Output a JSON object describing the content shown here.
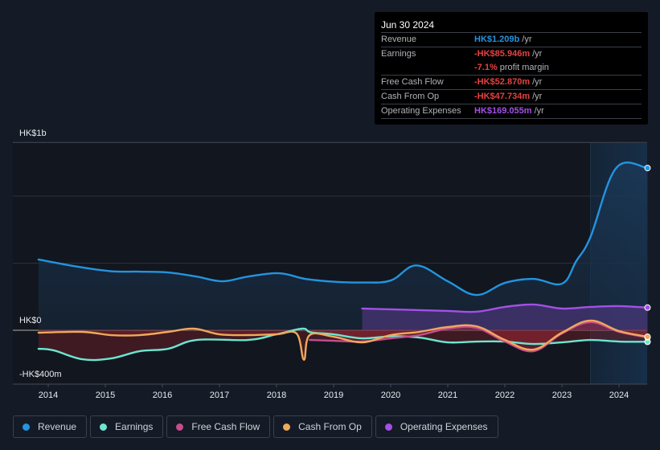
{
  "tooltip": {
    "date": "Jun 30 2024",
    "rows": [
      {
        "label": "Revenue",
        "value": "HK$1.209b",
        "unit": "/yr",
        "color": "#2394df"
      },
      {
        "label": "Earnings",
        "value": "-HK$85.946m",
        "unit": "/yr",
        "color": "#e64141"
      },
      {
        "label": "",
        "value": "-7.1%",
        "unit": "profit margin",
        "color": "#e64141"
      },
      {
        "label": "Free Cash Flow",
        "value": "-HK$52.870m",
        "unit": "/yr",
        "color": "#e64141"
      },
      {
        "label": "Cash From Op",
        "value": "-HK$47.734m",
        "unit": "/yr",
        "color": "#e64141"
      },
      {
        "label": "Operating Expenses",
        "value": "HK$169.055m",
        "unit": "/yr",
        "color": "#a450e6"
      }
    ]
  },
  "legend": [
    {
      "label": "Revenue",
      "color": "#2394df"
    },
    {
      "label": "Earnings",
      "color": "#6ce5d1"
    },
    {
      "label": "Free Cash Flow",
      "color": "#c84b8b"
    },
    {
      "label": "Cash From Op",
      "color": "#f0a95a"
    },
    {
      "label": "Operating Expenses",
      "color": "#a450e6"
    }
  ],
  "chart_data": {
    "type": "line",
    "title": "",
    "xlabel": "",
    "ylabel": "",
    "currency": "HK$",
    "units": "millions",
    "y_axis_labels": [
      "HK$1b",
      "HK$0",
      "-HK$400m"
    ],
    "ylim": [
      -400,
      1400
    ],
    "xlim": [
      2013.8,
      2024.5
    ],
    "x_ticks": [
      "2014",
      "2015",
      "2016",
      "2017",
      "2018",
      "2019",
      "2020",
      "2021",
      "2022",
      "2023",
      "2024"
    ],
    "grid": true,
    "highlight_from": 2023.5,
    "series": [
      {
        "name": "Revenue",
        "color": "#2394df",
        "x": [
          2013.83,
          2014.5,
          2015.1,
          2015.6,
          2016.1,
          2016.6,
          2017.05,
          2017.5,
          2018.05,
          2018.5,
          2019.0,
          2019.5,
          2020.0,
          2020.45,
          2021.0,
          2021.5,
          2022.0,
          2022.5,
          2023.0,
          2023.25,
          2023.5,
          2023.95,
          2024.5
        ],
        "values": [
          527,
          475,
          440,
          437,
          431,
          400,
          365,
          400,
          425,
          383,
          362,
          356,
          371,
          483,
          365,
          263,
          353,
          383,
          347,
          515,
          695,
          1209,
          1209
        ]
      },
      {
        "name": "Earnings",
        "color": "#6ce5d1",
        "x": [
          2013.83,
          2014.1,
          2014.6,
          2015.1,
          2015.6,
          2016.1,
          2016.6,
          2017.5,
          2018.0,
          2018.45,
          2018.6,
          2019.0,
          2019.5,
          2020.0,
          2020.5,
          2021.0,
          2021.5,
          2022.0,
          2022.5,
          2023.0,
          2023.5,
          2024.0,
          2024.5
        ],
        "values": [
          -138,
          -150,
          -216,
          -210,
          -156,
          -138,
          -72,
          -72,
          -30,
          12,
          -15,
          -30,
          -60,
          -45,
          -54,
          -90,
          -84,
          -84,
          -102,
          -90,
          -72,
          -84,
          -86
        ]
      },
      {
        "name": "Free Cash Flow",
        "color": "#c84b8b",
        "x": [
          2018.58,
          2019.0,
          2019.5,
          2020.0,
          2020.5,
          2021.0,
          2021.5,
          2022.0,
          2022.5,
          2023.0,
          2023.5,
          2024.0,
          2024.5
        ],
        "values": [
          -72,
          -78,
          -84,
          -60,
          -36,
          12,
          18,
          -84,
          -156,
          -24,
          60,
          -12,
          -53
        ]
      },
      {
        "name": "Cash From Op",
        "color": "#f0a95a",
        "x": [
          2013.83,
          2014.6,
          2015.1,
          2015.6,
          2016.1,
          2016.55,
          2017.0,
          2017.5,
          2018.0,
          2018.35,
          2018.48,
          2018.58,
          2019.0,
          2019.5,
          2020.0,
          2020.5,
          2021.0,
          2021.5,
          2022.0,
          2022.5,
          2023.0,
          2023.5,
          2024.0,
          2024.5
        ],
        "values": [
          -18,
          -12,
          -36,
          -36,
          -12,
          12,
          -30,
          -36,
          -30,
          -24,
          -220,
          -36,
          -48,
          -90,
          -36,
          -12,
          24,
          30,
          -72,
          -144,
          -18,
          72,
          -6,
          -48
        ]
      },
      {
        "name": "Operating Expenses",
        "color": "#a450e6",
        "x": [
          2019.5,
          2020.0,
          2020.5,
          2021.0,
          2021.5,
          2022.0,
          2022.5,
          2023.0,
          2023.5,
          2024.0,
          2024.5
        ],
        "values": [
          162,
          156,
          150,
          144,
          138,
          174,
          192,
          162,
          174,
          180,
          169
        ]
      }
    ]
  }
}
